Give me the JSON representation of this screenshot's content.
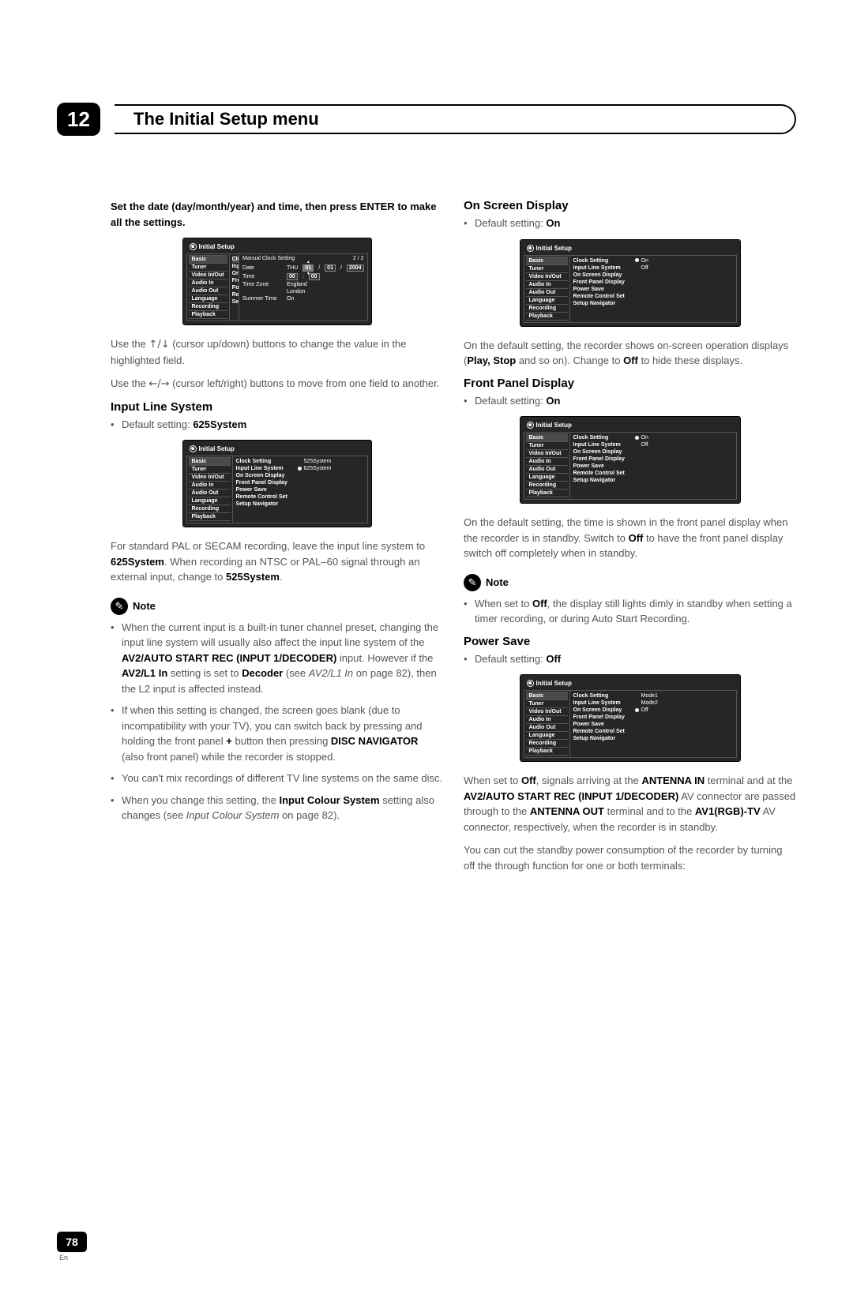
{
  "page": {
    "chapter_num": "12",
    "chapter_title": "The Initial Setup menu",
    "page_number": "78",
    "lang": "En"
  },
  "left": {
    "intro_bold": "Set the date (day/month/year) and time, then press ENTER to make all the settings.",
    "cursor_ud_pre": "Use the ",
    "cursor_ud_arrows": "↑/↓",
    "cursor_ud_post": " (cursor up/down) buttons to change the value in the highlighted field.",
    "cursor_lr_pre": "Use the ",
    "cursor_lr_arrows": "←/→",
    "cursor_lr_post": " (cursor left/right) buttons to move from one field to another.",
    "ils_heading": "Input Line System",
    "ils_default_pre": "Default setting: ",
    "ils_default_val": "625System",
    "ils_para_a": "For standard PAL or SECAM recording, leave the input line system to ",
    "ils_para_b": "625System",
    "ils_para_c": ". When recording an NTSC or PAL–60 signal through an external input, change to ",
    "ils_para_d": "525System",
    "ils_para_e": ".",
    "note_label": "Note",
    "note1_a": "When the current input is a built-in tuner channel preset, changing the input line system will usually also affect the input line system of the ",
    "note1_b": "AV2/AUTO START REC (INPUT 1/DECODER)",
    "note1_c": " input. However if the ",
    "note1_d": "AV2/L1 In",
    "note1_e": " setting is set to ",
    "note1_f": "Decoder",
    "note1_g": " (see ",
    "note1_h": "AV2/L1 In",
    "note1_i": " on page 82), then the L2 input is affected instead.",
    "note2_a": "If when this setting is changed, the screen goes blank (due to incompatibility with your TV), you can switch back by pressing and holding the front panel ",
    "note2_b": "+",
    "note2_c": " button then pressing ",
    "note2_d": "DISC NAVIGATOR",
    "note2_e": " (also front panel) while the recorder is stopped.",
    "note3": "You can't mix recordings of different TV line systems on the same disc.",
    "note4_a": "When you change this setting, the ",
    "note4_b": "Input Colour System",
    "note4_c": " setting also changes (see ",
    "note4_d": "Input Colour System",
    "note4_e": " on page 82)."
  },
  "right": {
    "osd_heading": "On Screen Display",
    "osd_default_pre": "Default setting: ",
    "osd_default_val": "On",
    "osd_para_a": "On the default setting, the recorder shows on-screen operation displays (",
    "osd_para_b": "Play, Stop",
    "osd_para_c": " and so on). Change to ",
    "osd_para_d": "Off",
    "osd_para_e": " to hide these displays.",
    "fpd_heading": "Front Panel Display",
    "fpd_default_pre": "Default setting: ",
    "fpd_default_val": "On",
    "fpd_para_a": "On the default setting, the time is shown in the front panel display when the recorder is in standby. Switch to ",
    "fpd_para_b": "Off",
    "fpd_para_c": " to have the front panel display switch off completely when in standby.",
    "note_label": "Note",
    "fpd_note_a": "When set to ",
    "fpd_note_b": "Off",
    "fpd_note_c": ", the display still lights dimly in standby when setting a timer recording, or during Auto Start Recording.",
    "ps_heading": "Power Save",
    "ps_default_pre": "Default setting: ",
    "ps_default_val": "Off",
    "ps_para_a": "When set to ",
    "ps_para_b": "Off",
    "ps_para_c": ", signals arriving at the ",
    "ps_para_d": "ANTENNA IN",
    "ps_para_e": " terminal and at the ",
    "ps_para_f": "AV2/AUTO START REC (INPUT 1/DECODER)",
    "ps_para_g": " AV connector are passed through to the ",
    "ps_para_h": "ANTENNA OUT",
    "ps_para_i": " terminal and to the ",
    "ps_para_j": "AV1(RGB)-TV",
    "ps_para_k": " AV connector, respectively, when the recorder is in standby.",
    "ps_para2": "You can cut the standby power consumption of the recorder by turning off the through function for one or both terminals:"
  },
  "ss": {
    "title": "Initial Setup",
    "left_items": [
      "Basic",
      "Tuner",
      "Video In/Out",
      "Audio In",
      "Audio Out",
      "Language",
      "Recording",
      "Playback"
    ],
    "mid_items": [
      "Clock Setting",
      "Input Line System",
      "On Screen Display",
      "Front Panel Display",
      "Power Save",
      "Remote Control Set",
      "Setup Navigator"
    ],
    "ils_opts": [
      "525System",
      "625System"
    ],
    "on_off": [
      "On",
      "Off"
    ],
    "ps_opts": [
      "Mode1",
      "Mode2",
      "Off"
    ],
    "clock": {
      "header_title": "Manual Clock Setting",
      "page_indicator": "2 / 2",
      "mid_trunc": [
        "Clock",
        "Input",
        "On S",
        "Front",
        "Powe",
        "Remo",
        "Setu"
      ],
      "rows": {
        "date_label": "Date",
        "date_day": "THU",
        "date_d": "01",
        "date_m": "01",
        "date_y": "2004",
        "time_label": "Time",
        "time_h": "00",
        "time_m": "00",
        "tz_label": "Time Zone",
        "tz_v1": "England",
        "tz_v2": "London",
        "st_label": "Summer Time",
        "st_v": "On"
      }
    }
  }
}
